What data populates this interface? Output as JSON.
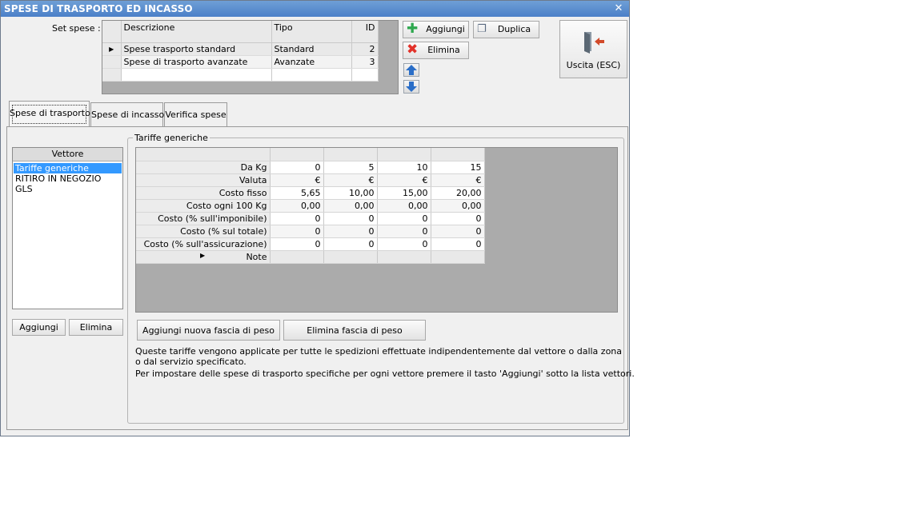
{
  "window": {
    "title": "SPESE DI TRASPORTO ED INCASSO",
    "close_glyph": "✕"
  },
  "set_spese": {
    "label": "Set spese :",
    "columns": [
      "Descrizione",
      "Tipo",
      "ID"
    ],
    "rows": [
      {
        "descrizione": "Spese trasporto standard",
        "tipo": "Standard",
        "id": "2"
      },
      {
        "descrizione": "Spese di trasporto avanzate",
        "tipo": "Avanzate",
        "id": "3"
      }
    ],
    "current_row_marker": "▶"
  },
  "toolbar": {
    "add_label": "Aggiungi",
    "duplicate_label": "Duplica",
    "delete_label": "Elimina",
    "exit_label": "Uscita (ESC)"
  },
  "tabs": [
    "Spese di trasporto",
    "Spese di incasso",
    "Verifica spese"
  ],
  "vettori": {
    "header": "Vettore",
    "items": [
      "Tariffe generiche",
      "RITIRO IN NEGOZIO",
      "GLS"
    ],
    "add_label": "Aggiungi",
    "delete_label": "Elimina"
  },
  "tariffe": {
    "group_title": "Tariffe generiche",
    "rows": [
      {
        "label": "Da Kg",
        "values": [
          "0",
          "5",
          "10",
          "15"
        ]
      },
      {
        "label": "Valuta",
        "values": [
          "€",
          "€",
          "€",
          "€"
        ]
      },
      {
        "label": "Costo fisso",
        "values": [
          "5,65",
          "10,00",
          "15,00",
          "20,00"
        ]
      },
      {
        "label": "Costo ogni 100 Kg",
        "values": [
          "0,00",
          "0,00",
          "0,00",
          "0,00"
        ]
      },
      {
        "label": "Costo (% sull'imponibile)",
        "values": [
          "0",
          "0",
          "0",
          "0"
        ]
      },
      {
        "label": "Costo (% sul totale)",
        "values": [
          "0",
          "0",
          "0",
          "0"
        ]
      },
      {
        "label": "Costo (% sull'assicurazione)",
        "values": [
          "0",
          "0",
          "0",
          "0"
        ]
      },
      {
        "label": "Note",
        "values": [
          "",
          "",
          "",
          ""
        ]
      }
    ],
    "add_band_label": "Aggiungi nuova fascia di peso",
    "delete_band_label": "Elimina fascia di peso",
    "info_line1": "Queste tariffe vengono applicate per tutte le spedizioni effettuate indipendentemente dal vettore o dalla zona",
    "info_line2": "o dal servizio specificato.",
    "info_line3": "Per impostare delle spese di trasporto specifiche per ogni vettore premere il tasto 'Aggiungi' sotto la lista vettori."
  },
  "colors": {
    "title_bar": "#5a8dcd",
    "selection": "#3399ff",
    "add_icon": "#2fa84f",
    "delete_icon": "#e2322a",
    "arrow_icon": "#2a6ec8",
    "exit_icon": "#d24a2a"
  }
}
